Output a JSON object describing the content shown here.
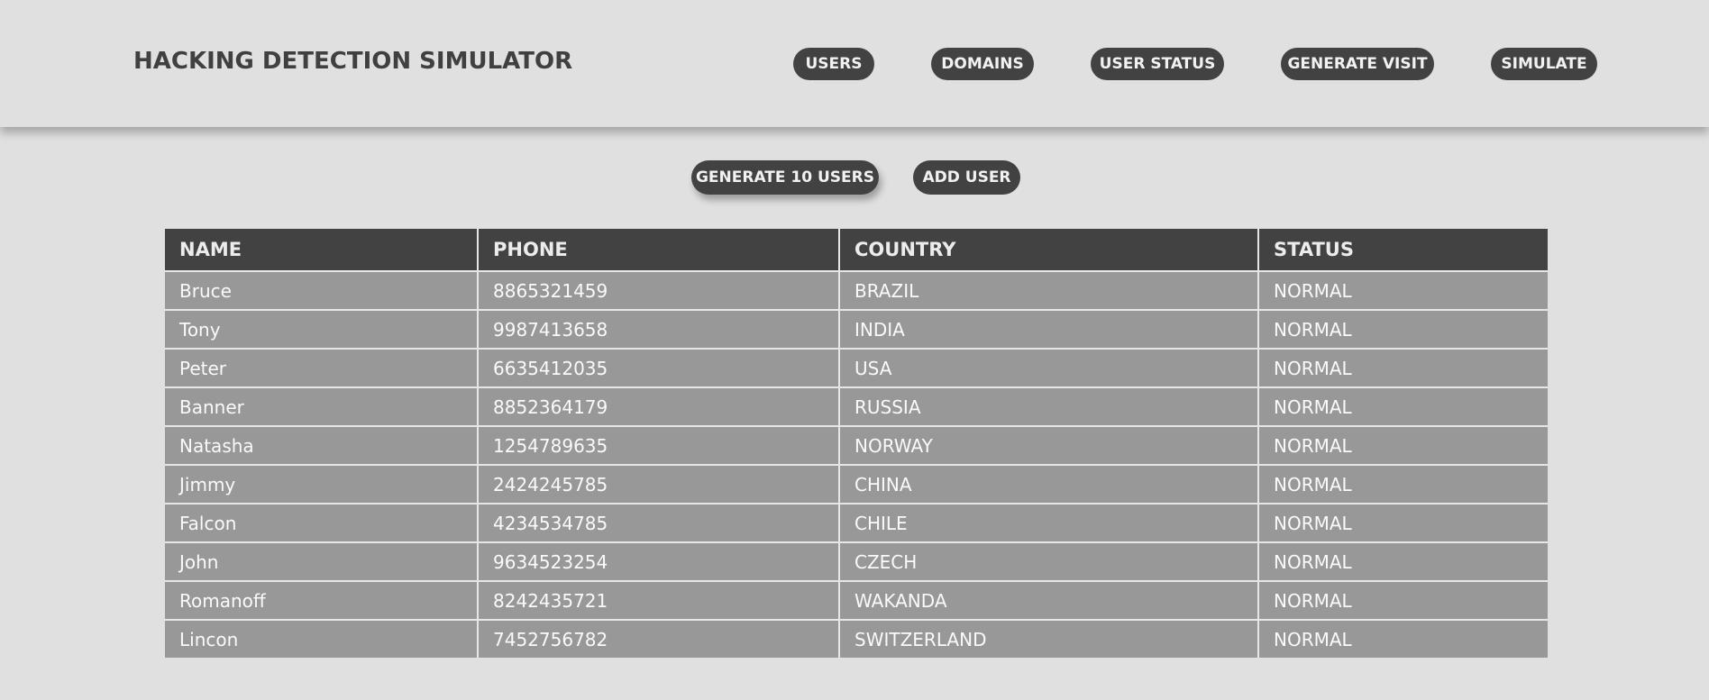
{
  "header": {
    "title": "HACKING DETECTION SIMULATOR",
    "nav": [
      "USERS",
      "DOMAINS",
      "USER STATUS",
      "GENERATE VISIT",
      "SIMULATE"
    ]
  },
  "actions": {
    "generate_label": "GENERATE 10 USERS",
    "add_label": "ADD USER"
  },
  "table": {
    "columns": [
      "NAME",
      "PHONE",
      "COUNTRY",
      "STATUS"
    ],
    "rows": [
      [
        "Bruce",
        "8865321459",
        "BRAZIL",
        "NORMAL"
      ],
      [
        "Tony",
        "9987413658",
        "INDIA",
        "NORMAL"
      ],
      [
        "Peter",
        "6635412035",
        "USA",
        "NORMAL"
      ],
      [
        "Banner",
        "8852364179",
        "RUSSIA",
        "NORMAL"
      ],
      [
        "Natasha",
        "1254789635",
        "NORWAY",
        "NORMAL"
      ],
      [
        "Jimmy",
        "2424245785",
        "CHINA",
        "NORMAL"
      ],
      [
        "Falcon",
        "4234534785",
        "CHILE",
        "NORMAL"
      ],
      [
        "John",
        "9634523254",
        "CZECH",
        "NORMAL"
      ],
      [
        "Romanoff",
        "8242435721",
        "WAKANDA",
        "NORMAL"
      ],
      [
        "Lincon",
        "7452756782",
        "SWITZERLAND",
        "NORMAL"
      ]
    ]
  },
  "colors": {
    "background": "#e0e0e0",
    "pill": "#424242",
    "header_cell": "#424242",
    "body_cell": "#989898"
  }
}
